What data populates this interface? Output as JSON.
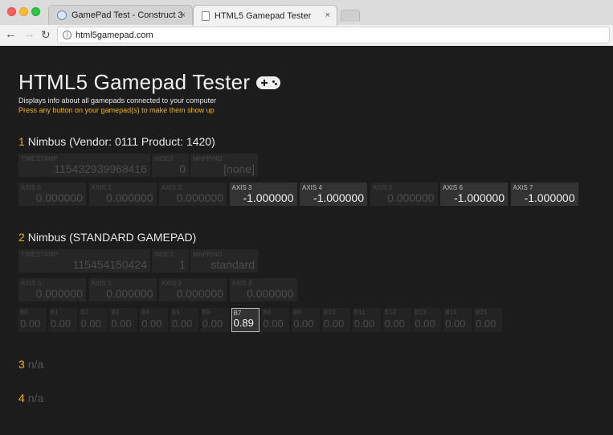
{
  "browser": {
    "tabs": [
      {
        "title": "GamePad Test - Construct 3",
        "close": "×"
      },
      {
        "title": "HTML5 Gamepad Tester",
        "close": "×"
      }
    ],
    "url": "html5gamepad.com"
  },
  "page": {
    "title": "HTML5 Gamepad Tester",
    "subtitle": "Displays info about all gamepads connected to your computer",
    "hint": "Press any button on your gamepad(s) to make them show up",
    "colors": {
      "accent": "#e9b213",
      "background": "#1c1c1c"
    }
  },
  "gamepads": [
    {
      "index": "1",
      "name": "Nimbus (Vendor: 0111 Product: 1420)",
      "info": [
        {
          "label": "TIMESTAMP",
          "value": "115432939968416"
        },
        {
          "label": "INDEX",
          "value": "0"
        },
        {
          "label": "MAPPING",
          "value": "[none]"
        }
      ],
      "axes": [
        {
          "label": "AXIS 0",
          "value": "0.000000",
          "active": false
        },
        {
          "label": "AXIS 1",
          "value": "0.000000",
          "active": false
        },
        {
          "label": "AXIS 2",
          "value": "0.000000",
          "active": false
        },
        {
          "label": "AXIS 3",
          "value": "-1.000000",
          "active": true
        },
        {
          "label": "AXIS 4",
          "value": "-1.000000",
          "active": true
        },
        {
          "label": "AXIS 5",
          "value": "0.000000",
          "active": false
        },
        {
          "label": "AXIS 6",
          "value": "-1.000000",
          "active": true
        },
        {
          "label": "AXIS 7",
          "value": "-1.000000",
          "active": true
        }
      ]
    },
    {
      "index": "2",
      "name": "Nimbus (STANDARD GAMEPAD)",
      "info": [
        {
          "label": "TIMESTAMP",
          "value": "115454150424"
        },
        {
          "label": "INDEX",
          "value": "1"
        },
        {
          "label": "MAPPING",
          "value": "standard"
        }
      ],
      "axes": [
        {
          "label": "AXIS 0",
          "value": "0.000000",
          "active": false
        },
        {
          "label": "AXIS 1",
          "value": "0.000000",
          "active": false
        },
        {
          "label": "AXIS 2",
          "value": "0.000000",
          "active": false
        },
        {
          "label": "AXIS 3",
          "value": "0.000000",
          "active": false
        }
      ],
      "buttons": [
        {
          "label": "B0",
          "value": "0.00",
          "active": false
        },
        {
          "label": "B1",
          "value": "0.00",
          "active": false
        },
        {
          "label": "B2",
          "value": "0.00",
          "active": false
        },
        {
          "label": "B3",
          "value": "0.00",
          "active": false
        },
        {
          "label": "B4",
          "value": "0.00",
          "active": false
        },
        {
          "label": "B5",
          "value": "0.00",
          "active": false
        },
        {
          "label": "B6",
          "value": "0.00",
          "active": false
        },
        {
          "label": "B7",
          "value": "0.89",
          "active": true
        },
        {
          "label": "B8",
          "value": "0.00",
          "active": false
        },
        {
          "label": "B9",
          "value": "0.00",
          "active": false
        },
        {
          "label": "B10",
          "value": "0.00",
          "active": false
        },
        {
          "label": "B11",
          "value": "0.00",
          "active": false
        },
        {
          "label": "B12",
          "value": "0.00",
          "active": false
        },
        {
          "label": "B13",
          "value": "0.00",
          "active": false
        },
        {
          "label": "B14",
          "value": "0.00",
          "active": false
        },
        {
          "label": "B15",
          "value": "0.00",
          "active": false
        }
      ]
    },
    {
      "index": "3",
      "name": "n/a"
    },
    {
      "index": "4",
      "name": "n/a"
    }
  ]
}
